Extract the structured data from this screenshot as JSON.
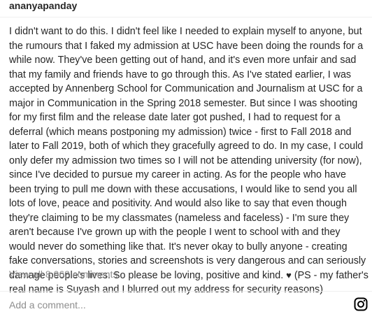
{
  "post": {
    "username": "ananyapanday",
    "caption_parts": {
      "before_heart": "I didn't want to do this. I didn't feel like I needed to explain myself to anyone, but the rumours that I faked my admission at USC have been doing the rounds for a while now. They've been getting out of hand, and it's even more unfair and sad that my family and friends have to go through this. As I've stated earlier, I was accepted by Annenberg School for Communication and Journalism at USC for a major in Communication in the Spring 2018 semester. But since I was shooting for my first film and the release date later got pushed, I had to request for a deferral (which means postponing my admission) twice - first to Fall 2018 and later to Fall 2019, both of which they gracefully agreed to do. In my case, I could only defer my admission two times so I will not be attending university (for now), since I've decided to pursue my career in acting. As for the people who have been trying to pull me down with these accusations, I would like to send you all lots of love, peace and positivity. And would also like to say that even though they're claiming to be my classmates (nameless and faceless) - I'm sure they aren't because I've grown up with the people I went to school with and they would never do something like that. It's never okay to bully anyone - creating fake conversations, stories and screenshots is very dangerous and can seriously damage people's lives. So please be loving, positive and kind. ",
      "heart": "♥",
      "after_heart": " (PS - my father's real name is Suyash and I blurred out my address for security reasons)"
    },
    "view_comments": "View all 8,063 comments",
    "add_comment_placeholder": "Add a comment..."
  },
  "icons": {
    "instagram": "instagram-icon"
  }
}
